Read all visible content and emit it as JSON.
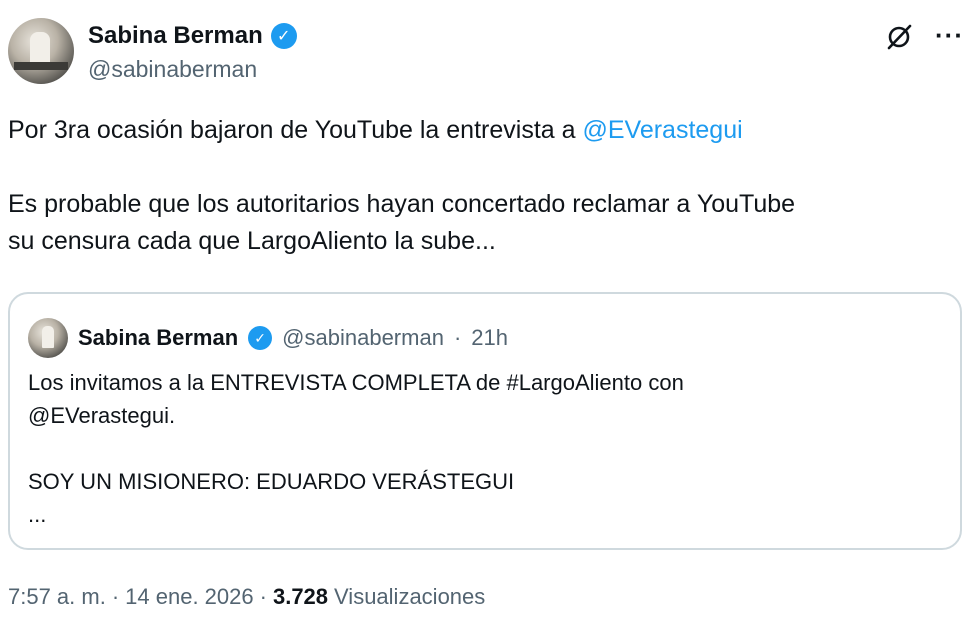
{
  "author": {
    "name": "Sabina Berman",
    "handle": "@sabinaberman"
  },
  "icons": {
    "verified": "verified-badge-icon",
    "grok": "grok-slash-icon",
    "more": "more-options-icon"
  },
  "tweet": {
    "line1_text": "Por 3ra ocasión bajaron de YouTube la entrevista a ",
    "line1_mention": "@EVerastegui",
    "line2": "Es probable que los autoritarios hayan concertado reclamar a YouTube",
    "line3": "su censura cada que LargoAliento la sube..."
  },
  "quote": {
    "name": "Sabina Berman",
    "handle": "@sabinaberman",
    "separator": "·",
    "time": "21h",
    "line1": "Los invitamos a la ENTREVISTA COMPLETA de #LargoAliento con",
    "line2": "@EVerastegui.",
    "line3": "SOY UN MISIONERO: EDUARDO VERÁSTEGUI",
    "line4": "..."
  },
  "meta": {
    "time": "7:57 a. m.",
    "sep1": "·",
    "date": "14 ene. 2026",
    "sep2": "·",
    "views_count": "3.728",
    "views_label": "Visualizaciones"
  },
  "colors": {
    "accent": "#1d9bf0",
    "secondary_text": "#536471",
    "border": "#cfd9de"
  }
}
